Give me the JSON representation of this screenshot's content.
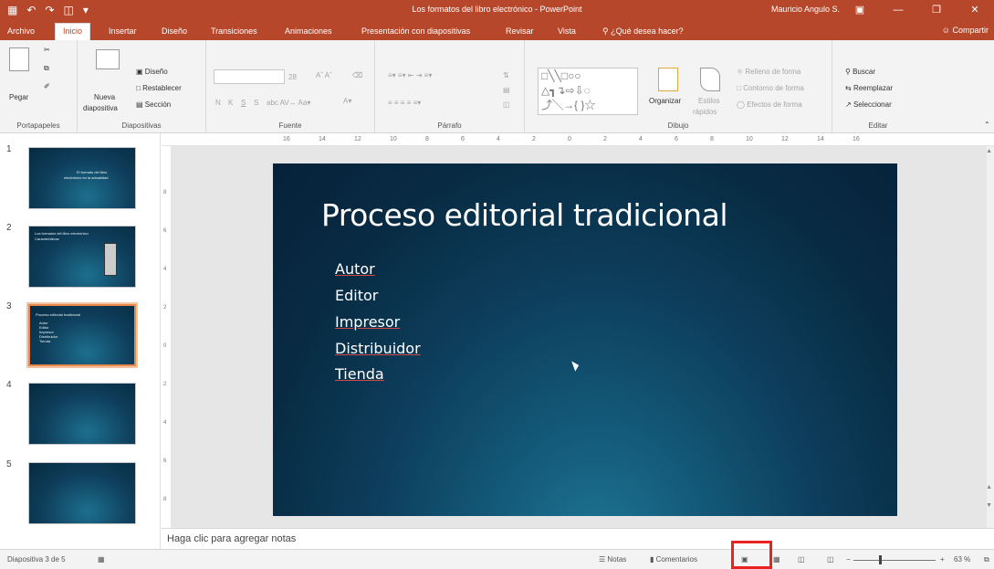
{
  "titlebar": {
    "title": "Los formatos del libro electrónico - PowerPoint",
    "user": "Mauricio Angulo S.",
    "qat": [
      "save-icon",
      "undo-icon",
      "redo-icon",
      "start-from-beginning-icon",
      "customize-icon"
    ],
    "bg_color": "#b7472a"
  },
  "tabs": [
    "Archivo",
    "Inicio",
    "Insertar",
    "Diseño",
    "Transiciones",
    "Animaciones",
    "Presentación con diapositivas",
    "Revisar",
    "Vista"
  ],
  "tell_me": "¿Qué desea hacer?",
  "share": "Compartir",
  "ribbon": {
    "portapapeles": {
      "label": "Portapapeles",
      "paste": "Pegar"
    },
    "diapositivas": {
      "label": "Diapositivas",
      "new_slide": "Nueva",
      "new_slide2": "diapositiva",
      "layout": "Diseño",
      "reset": "Restablecer",
      "section": "Sección"
    },
    "fuente": {
      "label": "Fuente",
      "size": "28",
      "bold": "N",
      "italic": "K",
      "underline": "S",
      "strike": "S"
    },
    "parrafo": {
      "label": "Párrafo"
    },
    "dibujo": {
      "label": "Dibujo",
      "arrange": "Organizar",
      "styles": "Estilos",
      "styles2": "rápidos",
      "fill": "Relleno de forma",
      "outline": "Contorno de forma",
      "effects": "Efectos de forma"
    },
    "editar": {
      "label": "Editar",
      "find": "Buscar",
      "replace": "Reemplazar",
      "select": "Seleccionar"
    }
  },
  "ruler": [
    "16",
    "14",
    "12",
    "10",
    "8",
    "6",
    "4",
    "2",
    "0",
    "2",
    "4",
    "6",
    "8",
    "10",
    "12",
    "14",
    "16"
  ],
  "vruler": [
    "8",
    "6",
    "4",
    "2",
    "0",
    "2",
    "4",
    "6",
    "8"
  ],
  "thumbnails": [
    {
      "num": "1",
      "lines": [
        "El formato del libro",
        "electrónico en la actualidad"
      ]
    },
    {
      "num": "2",
      "lines": [
        "Los formatos del libro electrónico",
        "Características"
      ]
    },
    {
      "num": "3",
      "lines": [
        "Proceso editorial tradicional",
        "Autor",
        "Editor",
        "Impresor",
        "Distribuidor",
        "Tienda"
      ]
    },
    {
      "num": "4",
      "lines": []
    },
    {
      "num": "5",
      "lines": []
    }
  ],
  "slide": {
    "title": "Proceso editorial tradicional",
    "bullets": [
      "Autor",
      "Editor",
      "Impresor",
      "Distribuidor",
      "Tienda"
    ]
  },
  "notes_placeholder": "Haga clic para agregar notas",
  "status": {
    "slide_count": "Diapositiva 3 de 5",
    "notes": "Notas",
    "comments": "Comentarios",
    "zoom": "63 %"
  }
}
